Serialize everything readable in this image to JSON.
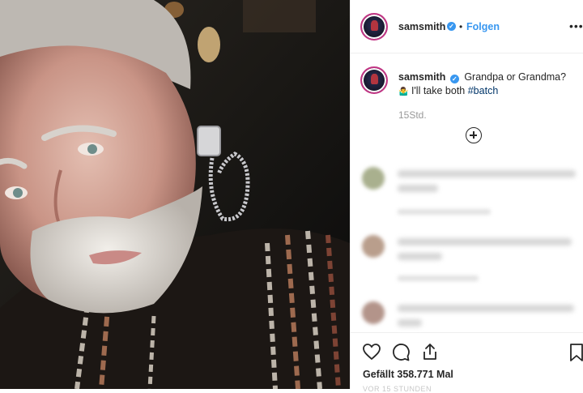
{
  "post": {
    "username": "samsmith",
    "follow_label": "Folgen",
    "separator": "•",
    "more_menu": "•••",
    "caption_line1": "Grandpa or Grandma?",
    "caption_emoji": "🤷‍♂️",
    "caption_line2_text": "I'll take both ",
    "caption_hashtag": "#batch",
    "time_ago": "15Std.",
    "likes_text": "Gefällt 358.771 Mal",
    "date_text": "VOR 15 STUNDEN"
  },
  "colors": {
    "link": "#3897f0",
    "hashtag": "#003569",
    "text": "#262626",
    "muted": "#999999",
    "verified": "#3897f0"
  },
  "icons": {
    "verified": "verified-badge-icon",
    "add_comments": "plus-circle-icon",
    "like": "heart-icon",
    "comment": "comment-bubble-icon",
    "share": "share-icon",
    "save": "bookmark-icon",
    "more": "more-options-icon"
  }
}
